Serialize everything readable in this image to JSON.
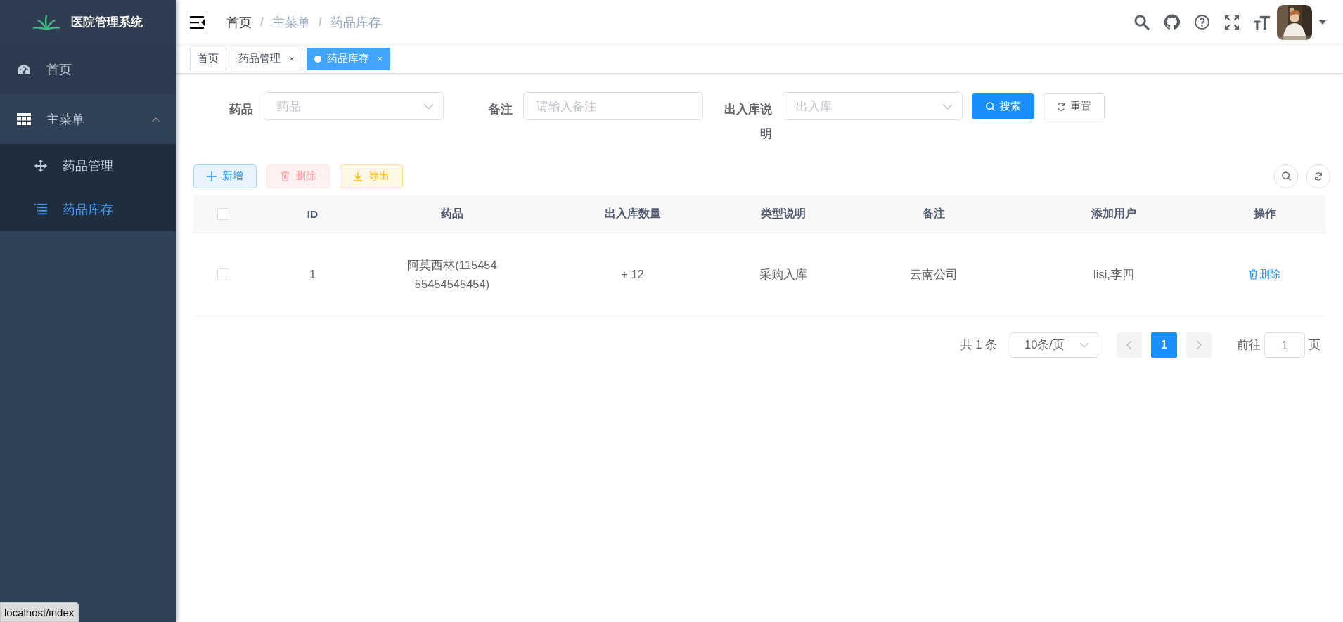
{
  "app": {
    "title": "医院管理系统"
  },
  "sidebar": {
    "items": [
      {
        "kind": "link",
        "label": "首页",
        "selected": false
      },
      {
        "kind": "group",
        "label": "主菜单",
        "expanded": true,
        "children": [
          {
            "label": "药品管理",
            "selected": false
          },
          {
            "label": "药品库存",
            "selected": true
          }
        ]
      }
    ]
  },
  "breadcrumb": [
    {
      "label": "首页"
    },
    {
      "separator": "/",
      "label": "主菜单"
    },
    {
      "separator": "/",
      "label": "药品库存"
    }
  ],
  "tags": [
    {
      "label": "首页",
      "selected": false
    },
    {
      "label": "药品管理",
      "selected": false,
      "close": "×"
    },
    {
      "label": "药品库存",
      "selected": true,
      "close": "×"
    }
  ],
  "search": {
    "fields": [
      {
        "label": "药品",
        "kind": "select",
        "placeholder": "药品"
      },
      {
        "label": "备注",
        "kind": "input",
        "placeholder": "请输入备注"
      },
      {
        "label": "出入库说明",
        "kind": "select",
        "placeholder": "出入库"
      }
    ],
    "buttons": [
      {
        "label": "搜索",
        "kind": "primary"
      },
      {
        "label": "重置",
        "kind": "default"
      }
    ]
  },
  "toolbar": {
    "buttons": [
      {
        "label": "新增",
        "kind": "primary",
        "disabled": false
      },
      {
        "label": "删除",
        "kind": "danger",
        "disabled": true
      },
      {
        "label": "导出",
        "kind": "warning",
        "disabled": false
      }
    ]
  },
  "table": {
    "select_all": {
      "checked": false
    },
    "columns": [
      "ID",
      "药品",
      "出入库数量",
      "类型说明",
      "备注",
      "添加用户",
      "操作"
    ],
    "rows": [
      {
        "checked": false,
        "cells": [
          "1",
          "阿莫西林(11545455454545454)",
          "+ 12",
          "采购入库",
          "云南公司",
          "lisi,李四"
        ],
        "action": "删除"
      }
    ]
  },
  "pagination": {
    "total": "共 1 条",
    "page_size": "10条/页",
    "pages": [
      {
        "label": "1",
        "selected": true
      }
    ],
    "jump_label": "前往",
    "jump_value": "1",
    "jump_suffix": "页"
  },
  "status_url": "localhost/index"
}
